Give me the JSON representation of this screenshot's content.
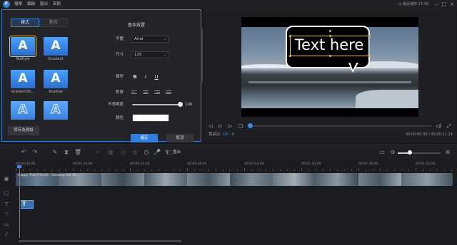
{
  "app": {
    "menus": [
      "檔案",
      "編輯",
      "匯出",
      "幫助"
    ],
    "login_status": "最近儲存 17:39",
    "logo_letter": "F"
  },
  "edit_panel": {
    "tabs": [
      "樣式",
      "動效"
    ],
    "styles": [
      {
        "label": "NoStyle",
        "selected": true,
        "hollow": false
      },
      {
        "label": "Gradient",
        "selected": false,
        "hollow": false
      },
      {
        "label": "GradientSh...",
        "selected": false,
        "hollow": false
      },
      {
        "label": "Shadow",
        "selected": false,
        "hollow": false
      },
      {
        "label": "",
        "selected": false,
        "hollow": true
      },
      {
        "label": "",
        "selected": false,
        "hollow": true
      }
    ],
    "save_preset": "保存為預設",
    "basic_settings_title": "基本設置",
    "font_label": "字體",
    "font_value": "Arial",
    "size_label": "尺寸",
    "size_value": "125",
    "format_label": "類型",
    "format_buttons": [
      "B",
      "I",
      "U"
    ],
    "align_label": "對齊",
    "opacity_label": "不透明度",
    "opacity_value": "100",
    "color_label": "顏色",
    "color_value": "#ffffff",
    "ok_label": "確定",
    "cancel_label": "取消"
  },
  "preview": {
    "overlay_text": "Text here",
    "aspect_label": "寬高比:",
    "aspect_value": "16 : 9",
    "time_readout": "00:00:00.00 / 00:05:11.14",
    "progress_fraction": 0.0
  },
  "toolbar": {
    "export_label": "匯出",
    "zoom_fraction": 0.27
  },
  "timeline": {
    "ticks": [
      "00:00:00.00",
      "00:00:16.00",
      "00:00:32.00",
      "00:00:48.00",
      "00:01:04.00",
      "00:01:20.00",
      "00:01:36.00",
      "00:01:52.00"
    ],
    "clip_label": "Happy Tree Friends - Stealing the Sh..."
  },
  "colors": {
    "accent": "#2f7fe0",
    "panel_border": "#3b7fd6",
    "aspect_value": "#3b9cf0"
  }
}
